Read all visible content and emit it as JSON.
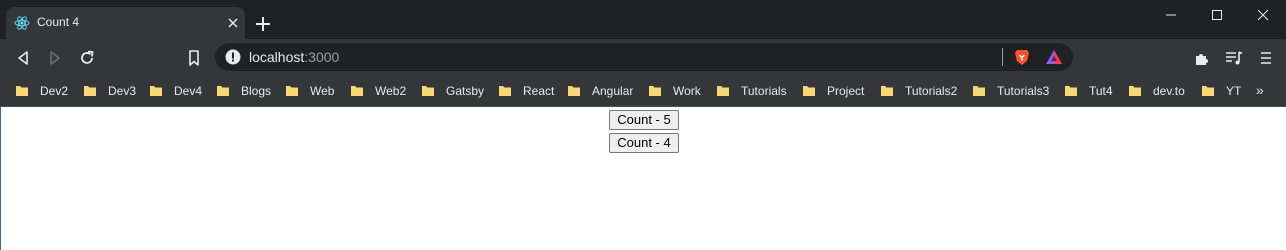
{
  "browser": {
    "tab": {
      "title": "Count 4"
    },
    "address": {
      "host": "localhost",
      "port": ":3000"
    },
    "bookmarks": [
      "Dev2",
      "Dev3",
      "Dev4",
      "Blogs",
      "Web",
      "Web2",
      "Gatsby",
      "React",
      "Angular",
      "Work",
      "Tutorials",
      "Project",
      "Tutorials2",
      "Tutorials3",
      "Tut4",
      "dev.to",
      "YT"
    ],
    "more_bookmarks": "»"
  },
  "page": {
    "buttons": [
      "Count - 5",
      "Count - 4"
    ]
  },
  "colors": {
    "titlebar": "#202124",
    "toolbar": "#35363a",
    "omnibox": "#202124",
    "folder": "#f8d775",
    "brave_orange": "#fb542b"
  },
  "icons": [
    "react-favicon-icon",
    "close-icon",
    "plus-icon",
    "minimize-icon",
    "maximize-icon",
    "close-window-icon",
    "back-icon",
    "forward-icon",
    "reload-icon",
    "bookmark-icon",
    "info-icon",
    "brave-shield-icon",
    "brave-rewards-icon",
    "extensions-icon",
    "media-controls-icon",
    "menu-icon",
    "folder-icon"
  ]
}
